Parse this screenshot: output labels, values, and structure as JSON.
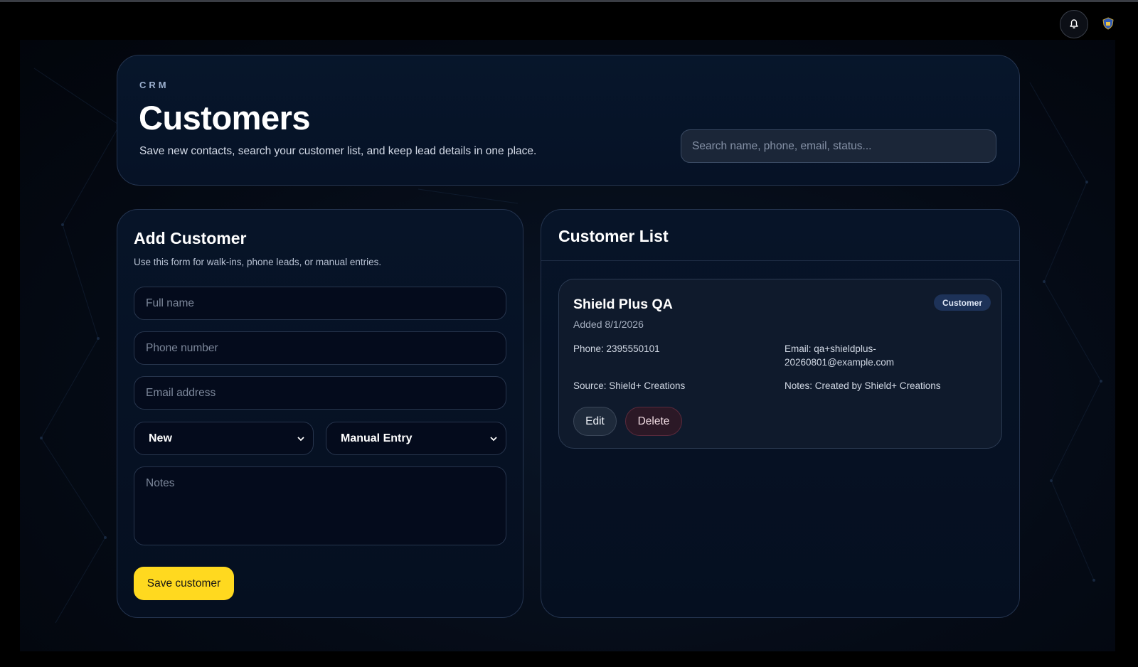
{
  "header": {
    "eyebrow": "CRM",
    "title": "Customers",
    "subtitle": "Save new contacts, search your customer list, and keep lead details in one place.",
    "search_placeholder": "Search name, phone, email, status..."
  },
  "topbar": {
    "notification_icon": "bell-icon",
    "avatar_icon": "shield-badge-icon"
  },
  "add_customer": {
    "title": "Add Customer",
    "description": "Use this form for walk-ins, phone leads, or manual entries.",
    "full_name_placeholder": "Full name",
    "phone_placeholder": "Phone number",
    "email_placeholder": "Email address",
    "status_selected": "New",
    "source_selected": "Manual Entry",
    "notes_placeholder": "Notes",
    "save_label": "Save customer"
  },
  "customer_list": {
    "title": "Customer List",
    "customers": [
      {
        "name": "Shield Plus QA",
        "added": "Added 8/1/2026",
        "badge": "Customer",
        "phone": "Phone: 2395550101",
        "email": "Email: qa+shieldplus-20260801@example.com",
        "source": "Source: Shield+ Creations",
        "notes": "Notes: Created by Shield+ Creations",
        "edit_label": "Edit",
        "delete_label": "Delete"
      }
    ]
  },
  "colors": {
    "accent": "#ffd91f",
    "panel_bg": "#071428",
    "badge_bg": "#1d3258",
    "delete_bg": "#2b1826"
  }
}
